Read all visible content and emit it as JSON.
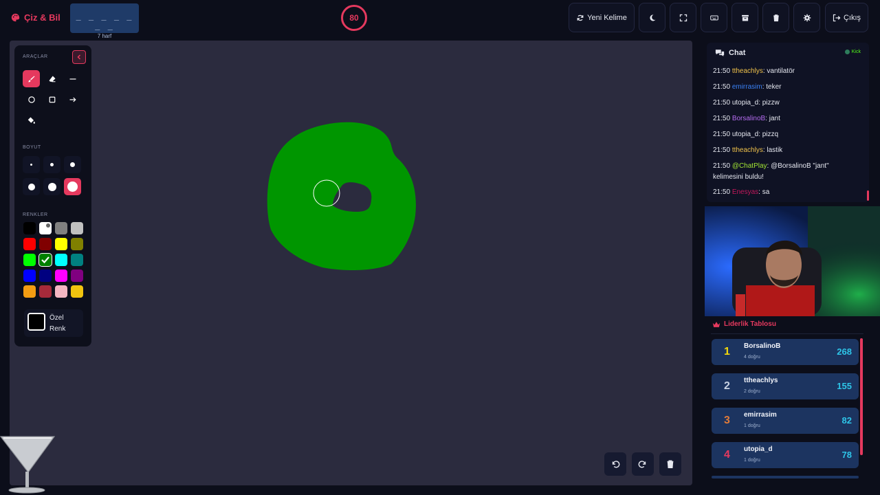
{
  "app": {
    "name": "Çiz & Bil",
    "brand_color": "#e5395e"
  },
  "word": {
    "dashes": "_ _ _ _ _ _ _",
    "length_label": "7 harf"
  },
  "timer": {
    "value": "80"
  },
  "toolbar": {
    "new_word_label": "Yeni Kelime",
    "exit_label": "Çıkış"
  },
  "tools_panel": {
    "tools_title": "ARAÇLAR",
    "size_title": "BOYUT",
    "colors_title": "RENKLER",
    "custom_color_label": "Özel Renk",
    "selected_tool": "brush",
    "selected_size": 6,
    "selected_color": "#008000",
    "colors": [
      "#000000",
      "#ffffff",
      "#808080",
      "#c0c0c0",
      "#ff0000",
      "#800000",
      "#ffff00",
      "#808000",
      "#00ff00",
      "#008000",
      "#00ffff",
      "#008080",
      "#0000ff",
      "#000080",
      "#ff00ff",
      "#800080",
      "#f39c12",
      "#a52a3a",
      "#f4b6c2",
      "#f1c40f"
    ]
  },
  "chat": {
    "title": "Chat",
    "platform": "Kick",
    "messages": [
      {
        "time": "21:50",
        "user": "ttheachlys",
        "user_color": "#f0c24b",
        "text": ": vantilatör"
      },
      {
        "time": "21:50",
        "user": "emirrasim",
        "user_color": "#3b82f6",
        "text": ": teker"
      },
      {
        "time": "21:50",
        "user": "utopia_d",
        "user_color": "#e6e8f0",
        "text": ": pizzw"
      },
      {
        "time": "21:50",
        "user": "BorsalinoB",
        "user_color": "#b56cf0",
        "text": ": jant"
      },
      {
        "time": "21:50",
        "user": "utopia_d",
        "user_color": "#e6e8f0",
        "text": ": pizzq"
      },
      {
        "time": "21:50",
        "user": "ttheachlys",
        "user_color": "#f0c24b",
        "text": ": lastik"
      },
      {
        "time": "21:50",
        "user": "@ChatPlay",
        "user_color": "#a3e635",
        "text": ": @BorsalinoB \"jant\" kelimesini buldu!"
      },
      {
        "time": "21:50",
        "user": "Enesyas",
        "user_color": "#c2185b",
        "text": ": sa"
      }
    ]
  },
  "leaderboard": {
    "title": "Liderlik Tablosu",
    "rows": [
      {
        "rank": "1",
        "rank_color": "#f5d90a",
        "name": "BorsalinoB",
        "sub": "4 doğru",
        "score": "268"
      },
      {
        "rank": "2",
        "rank_color": "#c9d2e3",
        "name": "ttheachlys",
        "sub": "2 doğru",
        "score": "155"
      },
      {
        "rank": "3",
        "rank_color": "#e07b39",
        "name": "emirrasim",
        "sub": "1 doğru",
        "score": "82"
      },
      {
        "rank": "4",
        "rank_color": "#e5395e",
        "name": "utopia_d",
        "sub": "1 doğru",
        "score": "78"
      }
    ]
  }
}
